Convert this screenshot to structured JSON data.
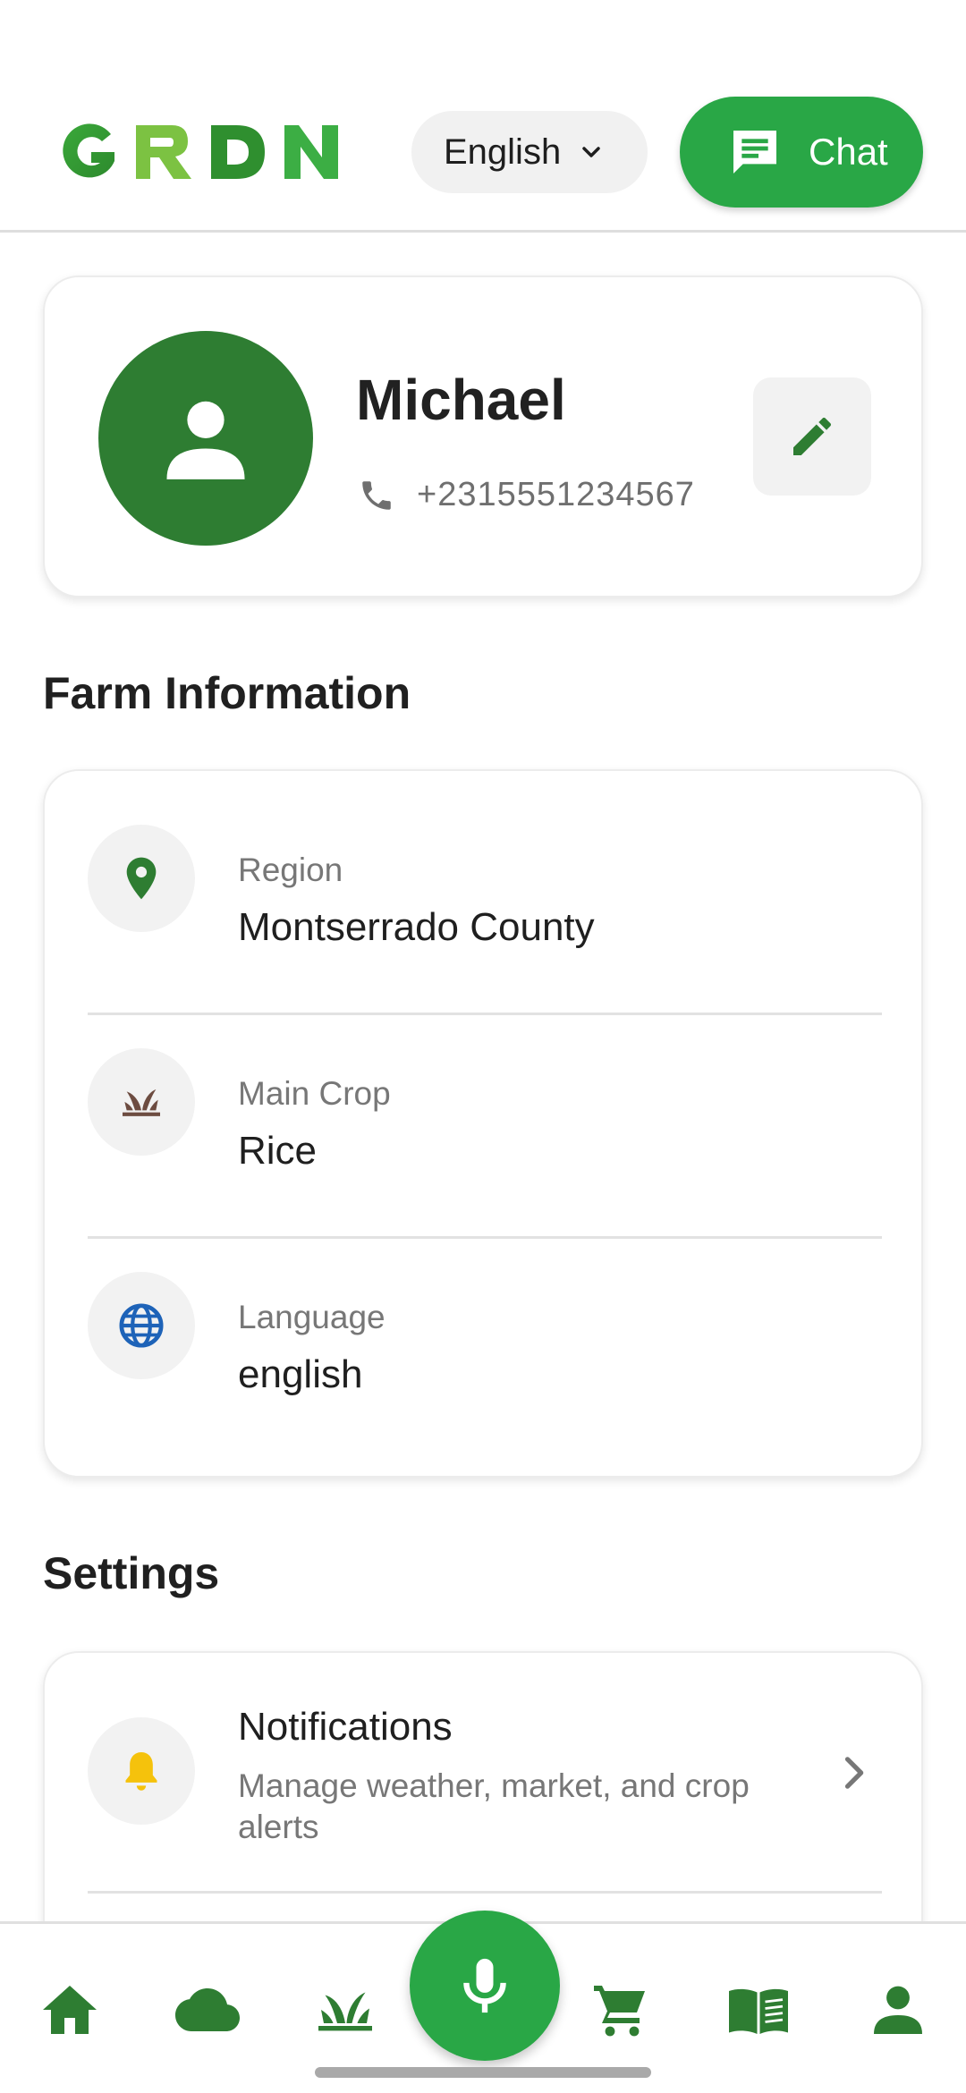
{
  "header": {
    "logo_text": "GRDN",
    "language_selector": {
      "selected": "English"
    },
    "chat_button": {
      "label": "Chat"
    }
  },
  "profile": {
    "name": "Michael",
    "phone": "+2315551234567"
  },
  "farm_info": {
    "title": "Farm Information",
    "items": [
      {
        "label": "Region",
        "value": "Montserrado County",
        "icon": "location-pin-icon"
      },
      {
        "label": "Main Crop",
        "value": "Rice",
        "icon": "crop-sprout-icon"
      },
      {
        "label": "Language",
        "value": "english",
        "icon": "globe-icon"
      }
    ]
  },
  "settings": {
    "title": "Settings",
    "items": [
      {
        "title": "Notifications",
        "description": "Manage weather, market, and crop alerts",
        "icon": "bell-icon"
      }
    ]
  },
  "bottom_nav": {
    "items": [
      "home-icon",
      "weather-cloud-icon",
      "crops-icon",
      "microphone-icon",
      "market-cart-icon",
      "guide-book-icon",
      "profile-icon"
    ]
  },
  "colors": {
    "brand_green": "#29a746",
    "dark_green": "#2e7d32",
    "crop_brown": "#6d4c41",
    "globe_blue": "#1e63b8",
    "bell_yellow": "#f5c20c"
  }
}
